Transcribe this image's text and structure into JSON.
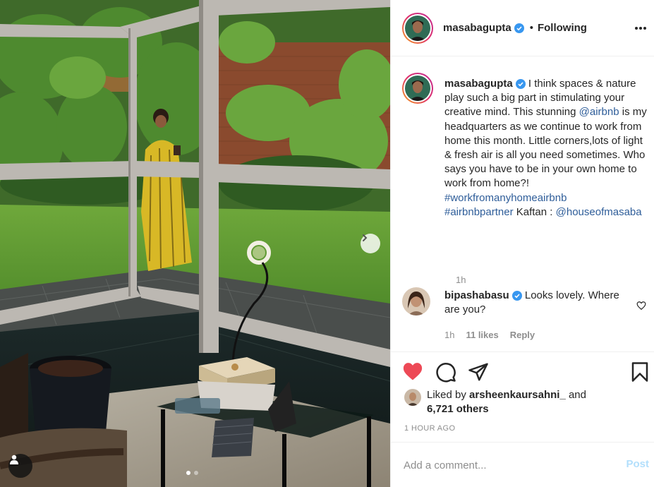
{
  "post": {
    "username": "masabagupta",
    "follow_state": "Following",
    "separator": "•",
    "caption": {
      "username": "masabagupta",
      "text_1": "I think spaces & nature play such a big part in stimulating your creative mind. This stunning ",
      "mention_1": "@airbnb",
      "text_2": " is my headquarters as we continue to work from home this month. Little corners,lots of light & fresh air is all you need sometimes. Who says you have to be in your own home to work from home?! ",
      "hashtag_1": "#workfromanyhomeairbnb",
      "hashtag_2": "#airbnbpartner",
      "text_3": " Kaftan : ",
      "mention_2": "@houseofmasaba",
      "time": "1h"
    },
    "comments": [
      {
        "username": "bipashabasu",
        "text": "Looks lovely. Where are you?",
        "time": "1h",
        "likes": "11 likes",
        "reply_label": "Reply"
      }
    ],
    "liked_by": {
      "prefix": "Liked by ",
      "user": "arsheenkaursahni_",
      "and": " and",
      "others": "6,721 others"
    },
    "timestamp": "1 HOUR AGO",
    "comment_box": {
      "placeholder": "Add a comment...",
      "post_label": "Post"
    }
  },
  "colors": {
    "like_red": "#ed4956",
    "link_blue": "#2e5d99",
    "verified_blue": "#3897f0",
    "post_disabled": "#b2dffc",
    "muted_gray": "#8e8e8e"
  },
  "icons": [
    "more-options-icon",
    "verified-badge-icon",
    "heart-icon",
    "comment-icon",
    "share-icon",
    "bookmark-icon",
    "next-arrow-icon",
    "user-tag-icon"
  ],
  "carousel": {
    "total_slides": 2,
    "active_slide": 1
  }
}
